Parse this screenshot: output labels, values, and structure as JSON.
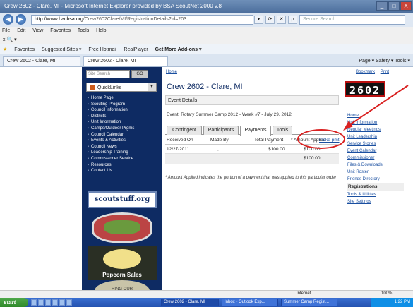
{
  "window": {
    "title": "Crew 2602 - Clare, MI - Microsoft Internet Explorer provided by BSA ScoutNet 2000 v.8",
    "min": "_",
    "max": "□",
    "close": "X"
  },
  "browser": {
    "back": "◀",
    "forward": "▶",
    "url_host": "http://www.hacbsa.org",
    "url_path": "/Crew2602Clare/MI/RegistrationDetails?id=203",
    "search_placeholder": "Secure Search",
    "menu": [
      "File",
      "Edit",
      "View",
      "Favorites",
      "Tools",
      "Help"
    ],
    "cmdrow": "x  🔍 ▾",
    "favorites": {
      "label": "Favorites",
      "items": [
        "Suggested Sites ▾",
        "Free Hotmail",
        "RealPlayer",
        "Get More Add-ons ▾"
      ]
    },
    "tabs": [
      "Crew 2602 - Clare, MI",
      "Crew 2602 - Clare, MI"
    ],
    "tab_tools": "Page ▾  Safety ▾  Tools ▾"
  },
  "sidebar": {
    "search_placeholder": "Site Search",
    "go_label": "GO",
    "quicklinks_label": "QuickLinks",
    "nav": [
      "Home Page",
      "Scouting Program",
      "Council Information",
      "Districts",
      "Unit Information",
      "Camps/Outdoor Prgms",
      "Council Calendar",
      "Events & Activities",
      "Council News",
      "Leadership Training",
      "Commissioner Service",
      "Resources",
      "Contact Us"
    ],
    "scoutstuff": "scoutstuff.org",
    "popcorn": "Popcorn Sales",
    "badge2_text": "RING OUR"
  },
  "main": {
    "home_link": "Home",
    "title": "Crew 2602 - Clare, MI",
    "event_details_header": "Event Details",
    "event_line": "Event: Rotary Summer Camp 2012 - Week #7 - July 29, 2012",
    "tabs": [
      "Contingent",
      "Participants",
      "Payments",
      "Tools"
    ],
    "active_tab": "Payments",
    "table": {
      "headers": [
        "Received On",
        "Made By",
        "Total Payment",
        "* Amount Applied"
      ],
      "make_payment": "make pmt",
      "rows": [
        {
          "received_on": "12/27/2011",
          "made_by": ",",
          "total_payment": "$100.00",
          "amount_applied": "$100.00"
        }
      ],
      "total": "$100.00"
    },
    "note": "* Amount Applied indicates the portion of a payment that was applied to this particular order"
  },
  "rightcol": {
    "bookmark": "Bookmark",
    "print": "Print",
    "unit_number": "2602",
    "links": [
      "Home",
      "Unit Information",
      "Regular Meetings",
      "Unit Leadership",
      "Service Stories",
      "Event Calendar",
      "Commissioner",
      "Files & Downloads",
      "Unit Roster",
      "Friends Directory"
    ],
    "registrations_header": "Registrations",
    "registration_links": [
      "Tools & Utilities",
      "Site Settings"
    ]
  },
  "statusbar": {
    "zone": "Internet",
    "zoom": "100%"
  },
  "taskbar": {
    "start": "start",
    "tasks": [
      "Crew 2602 - Clare, MI",
      "Inbox - Outlook Exp...",
      "Summer Camp Regist..."
    ],
    "clock": "1:22 PM"
  },
  "annotation_color": "#d92020"
}
